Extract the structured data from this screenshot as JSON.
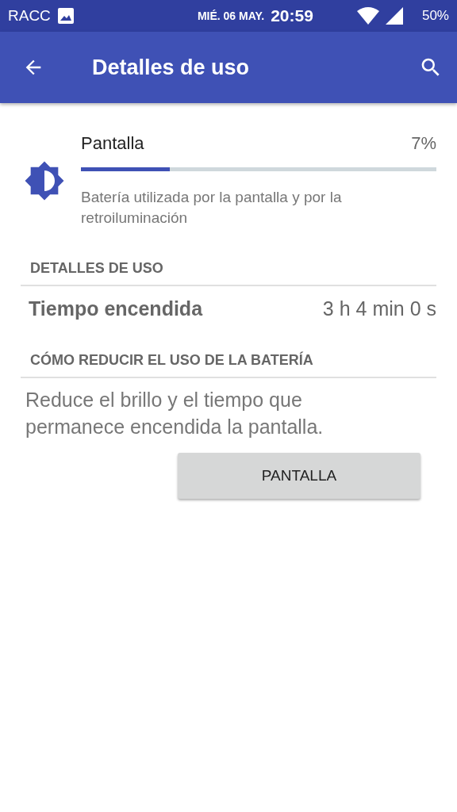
{
  "status_bar": {
    "carrier": "RACC",
    "date": "MIÉ. 06 MAY.",
    "time": "20:59",
    "battery": "50%"
  },
  "app_bar": {
    "title": "Detalles de uso"
  },
  "usage": {
    "name": "Pantalla",
    "percent": "7%",
    "level": 0.25,
    "description": "Batería utilizada por la pantalla y por la retroiluminación"
  },
  "sections": [
    {
      "kind": "detail",
      "header": "DETALLES DE USO",
      "label": "Tiempo encendida",
      "value": "3 h 4 min 0 s"
    },
    {
      "kind": "tip",
      "header": "CÓMO REDUCIR EL USO DE LA BATERÍA",
      "text": "Reduce el brillo y el tiempo que permanece encendida la pantalla.",
      "button": "PANTALLA"
    }
  ]
}
